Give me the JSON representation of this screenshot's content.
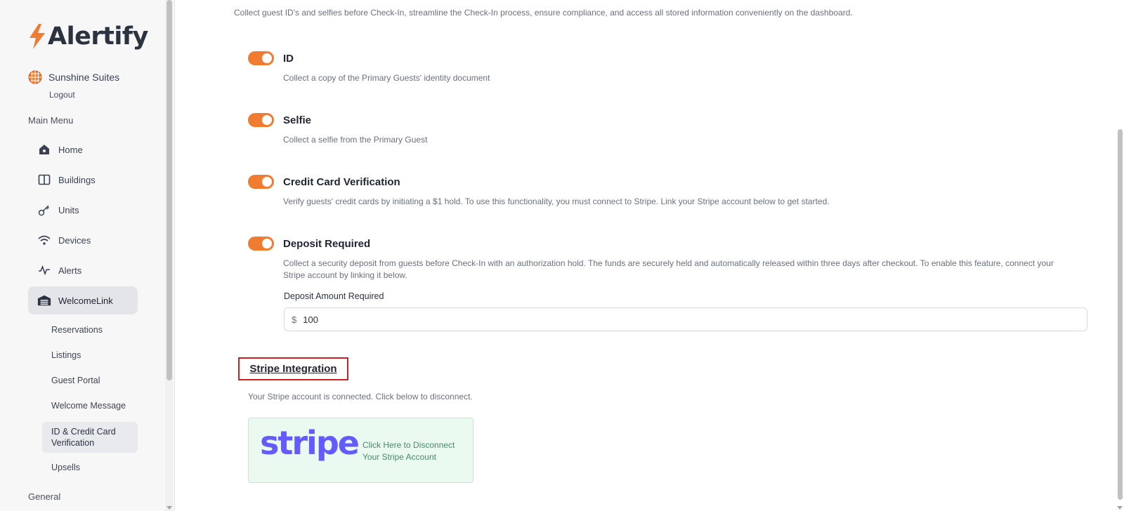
{
  "brand": {
    "name": "Alertify",
    "accent_color": "#f07c32"
  },
  "property": {
    "name": "Sunshine Suites",
    "icon": "property-globe-icon"
  },
  "sidebar": {
    "logout_label": "Logout",
    "main_menu_label": "Main Menu",
    "general_label": "General",
    "items": [
      {
        "label": "Home",
        "icon": "home-icon"
      },
      {
        "label": "Buildings",
        "icon": "book-icon"
      },
      {
        "label": "Units",
        "icon": "key-icon"
      },
      {
        "label": "Devices",
        "icon": "wifi-icon"
      },
      {
        "label": "Alerts",
        "icon": "activity-icon"
      },
      {
        "label": "WelcomeLink",
        "icon": "garage-icon",
        "active": true
      }
    ],
    "sub_items": [
      {
        "label": "Reservations"
      },
      {
        "label": "Listings"
      },
      {
        "label": "Guest Portal"
      },
      {
        "label": "Welcome Message"
      },
      {
        "label": "ID & Credit Card Verification",
        "active": true
      },
      {
        "label": "Upsells"
      }
    ]
  },
  "main": {
    "intro": "Collect guest ID's and selfies before Check-In, streamline the Check-In process, ensure compliance, and access all stored information conveniently on the dashboard.",
    "features": [
      {
        "title": "ID",
        "description": "Collect a copy of the Primary Guests' identity document",
        "enabled": true
      },
      {
        "title": "Selfie",
        "description": "Collect a selfie from the Primary Guest",
        "enabled": true
      },
      {
        "title": "Credit Card Verification",
        "description": "Verify guests' credit cards by initiating a $1 hold. To use this functionality, you must connect to Stripe. Link your Stripe account below to get started.",
        "enabled": true
      },
      {
        "title": "Deposit Required",
        "description": "Collect a security deposit from guests before Check-In with an authorization hold. The funds are securely held and automatically released within three days after checkout. To enable this feature, connect your Stripe account by linking it below.",
        "enabled": true
      }
    ],
    "deposit": {
      "label": "Deposit Amount Required",
      "currency": "$",
      "value": "100"
    },
    "stripe": {
      "heading": "Stripe Integration",
      "status": "Your Stripe account is connected. Click below to disconnect.",
      "wordmark": "stripe",
      "cta": "Click Here to Disconnect Your Stripe Account",
      "brand_color": "#635bff"
    }
  }
}
